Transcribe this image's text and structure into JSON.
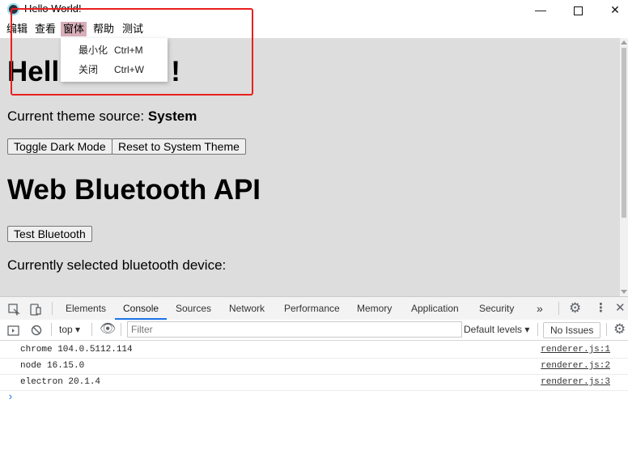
{
  "window": {
    "title": "Hello World!",
    "min_glyph": "—",
    "close_glyph": "✕"
  },
  "menu": {
    "items": [
      {
        "label": "编辑"
      },
      {
        "label": "查看"
      },
      {
        "label": "窗体"
      },
      {
        "label": "帮助"
      },
      {
        "label": "测试"
      }
    ],
    "active_index": 2,
    "dropdown": [
      {
        "label": "最小化",
        "shortcut": "Ctrl+M"
      },
      {
        "label": "关闭",
        "shortcut": "Ctrl+W"
      }
    ]
  },
  "page": {
    "heading1_partial": "Hell",
    "heading1_tail": "!",
    "theme_label": "Current theme source: ",
    "theme_value": "System",
    "toggle_dark_btn": "Toggle Dark Mode",
    "reset_theme_btn": "Reset to System Theme",
    "heading2": "Web Bluetooth API",
    "test_bluetooth_btn": "Test Bluetooth",
    "device_label": "Currently selected bluetooth device:"
  },
  "devtools": {
    "tabs": [
      "Elements",
      "Console",
      "Sources",
      "Network",
      "Performance",
      "Memory",
      "Application",
      "Security"
    ],
    "active_tab": "Console",
    "more_tabs": "»",
    "context": "top",
    "filter_placeholder": "Filter",
    "levels": "Default levels",
    "issues": "No Issues",
    "logs": [
      {
        "message": "chrome 104.0.5112.114",
        "source": "renderer.js:1"
      },
      {
        "message": "node 16.15.0",
        "source": "renderer.js:2"
      },
      {
        "message": "electron 20.1.4",
        "source": "renderer.js:3"
      }
    ],
    "prompt": "›"
  },
  "colors": {
    "menu_active": "#d7aeb9",
    "highlight_box": "#e8201f",
    "active_tab_underline": "#1a73e8"
  }
}
